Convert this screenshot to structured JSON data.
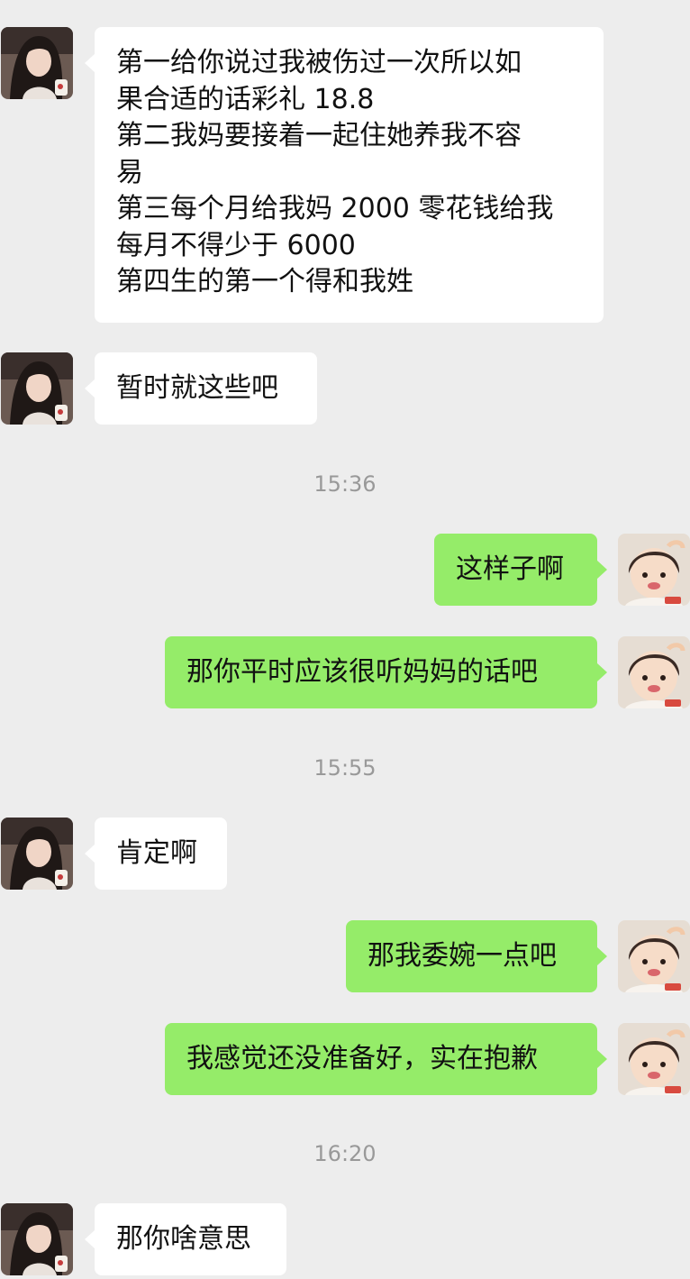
{
  "colors": {
    "background": "#ededed",
    "incoming_bubble": "#ffffff",
    "outgoing_bubble": "#95ec69",
    "timestamp": "#999999"
  },
  "messages": [
    {
      "from": "contact",
      "lines": [
        "第一给你说过我被伤过一次所以如",
        "果合适的话彩礼 18.8",
        "第二我妈要接着一起住她养我不容",
        "易",
        "第三每个月给我妈 2000 零花钱给我",
        "每月不得少于 6000",
        "第四生的第一个得和我姓"
      ]
    },
    {
      "from": "contact",
      "lines": [
        "暂时就这些吧"
      ]
    },
    {
      "timestamp": "15:36"
    },
    {
      "from": "me",
      "lines": [
        "这样子啊"
      ]
    },
    {
      "from": "me",
      "lines": [
        "那你平时应该很听妈妈的话吧"
      ]
    },
    {
      "timestamp": "15:55"
    },
    {
      "from": "contact",
      "lines": [
        "肯定啊"
      ]
    },
    {
      "from": "me",
      "lines": [
        "那我委婉一点吧"
      ]
    },
    {
      "from": "me",
      "lines": [
        "我感觉还没准备好，实在抱歉"
      ]
    },
    {
      "timestamp": "16:20"
    },
    {
      "from": "contact",
      "lines": [
        "那你啥意思"
      ]
    }
  ]
}
